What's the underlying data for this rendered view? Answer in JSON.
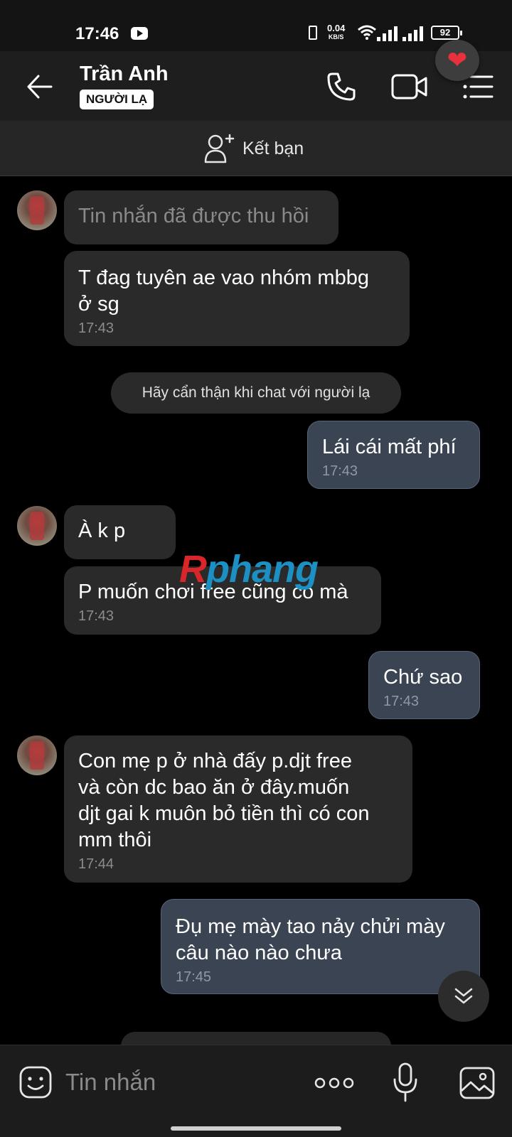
{
  "status_bar": {
    "time": "17:46",
    "net_speed": "0.04",
    "net_unit": "KB/S",
    "battery": "92"
  },
  "header": {
    "contact_name": "Trần Anh",
    "stranger_badge": "NGƯỜI LẠ"
  },
  "add_friend": {
    "label": "Kết bạn"
  },
  "messages": {
    "m1": {
      "text": "Tin nhắn đã được thu hồi"
    },
    "m2": {
      "text": "T đag tuyên ae vao nhóm mbbg\nở sg",
      "time": "17:43"
    },
    "notice": "Hãy cẩn thận khi chat với người lạ",
    "m3": {
      "text": "Lái cái mất phí",
      "time": "17:43"
    },
    "m4": {
      "text": "À k p"
    },
    "m5": {
      "text": "P muốn chơi free cũng có mà",
      "time": "17:43"
    },
    "m6": {
      "text": "Chứ sao",
      "time": "17:43"
    },
    "m7": {
      "text": "Con mẹ p ở nhà đấy p.djt free\nvà còn dc bao ăn ở đây.muốn\ndjt gai k muôn bỏ tiền thì có con\nmm thôi",
      "time": "17:44"
    },
    "m8": {
      "text": "Đụ mẹ mày tao nảy chửi mày\ncâu nào nào chưa",
      "time": "17:45"
    }
  },
  "watermark": {
    "first": "R",
    "rest": "phang"
  },
  "input": {
    "placeholder": "Tin nhắn"
  },
  "colors": {
    "incoming_bubble": "#2a2a2a",
    "outgoing_bubble": "#3a4452",
    "watermark_red": "#d8262b",
    "watermark_blue": "#1c8fc3"
  }
}
